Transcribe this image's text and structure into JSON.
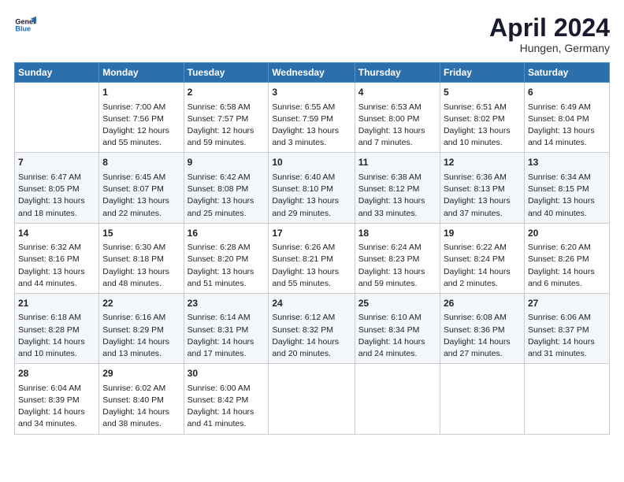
{
  "header": {
    "logo_line1": "General",
    "logo_line2": "Blue",
    "month": "April 2024",
    "location": "Hungen, Germany"
  },
  "days_of_week": [
    "Sunday",
    "Monday",
    "Tuesday",
    "Wednesday",
    "Thursday",
    "Friday",
    "Saturday"
  ],
  "weeks": [
    [
      {
        "day": "",
        "info": ""
      },
      {
        "day": "1",
        "info": "Sunrise: 7:00 AM\nSunset: 7:56 PM\nDaylight: 12 hours\nand 55 minutes."
      },
      {
        "day": "2",
        "info": "Sunrise: 6:58 AM\nSunset: 7:57 PM\nDaylight: 12 hours\nand 59 minutes."
      },
      {
        "day": "3",
        "info": "Sunrise: 6:55 AM\nSunset: 7:59 PM\nDaylight: 13 hours\nand 3 minutes."
      },
      {
        "day": "4",
        "info": "Sunrise: 6:53 AM\nSunset: 8:00 PM\nDaylight: 13 hours\nand 7 minutes."
      },
      {
        "day": "5",
        "info": "Sunrise: 6:51 AM\nSunset: 8:02 PM\nDaylight: 13 hours\nand 10 minutes."
      },
      {
        "day": "6",
        "info": "Sunrise: 6:49 AM\nSunset: 8:04 PM\nDaylight: 13 hours\nand 14 minutes."
      }
    ],
    [
      {
        "day": "7",
        "info": "Sunrise: 6:47 AM\nSunset: 8:05 PM\nDaylight: 13 hours\nand 18 minutes."
      },
      {
        "day": "8",
        "info": "Sunrise: 6:45 AM\nSunset: 8:07 PM\nDaylight: 13 hours\nand 22 minutes."
      },
      {
        "day": "9",
        "info": "Sunrise: 6:42 AM\nSunset: 8:08 PM\nDaylight: 13 hours\nand 25 minutes."
      },
      {
        "day": "10",
        "info": "Sunrise: 6:40 AM\nSunset: 8:10 PM\nDaylight: 13 hours\nand 29 minutes."
      },
      {
        "day": "11",
        "info": "Sunrise: 6:38 AM\nSunset: 8:12 PM\nDaylight: 13 hours\nand 33 minutes."
      },
      {
        "day": "12",
        "info": "Sunrise: 6:36 AM\nSunset: 8:13 PM\nDaylight: 13 hours\nand 37 minutes."
      },
      {
        "day": "13",
        "info": "Sunrise: 6:34 AM\nSunset: 8:15 PM\nDaylight: 13 hours\nand 40 minutes."
      }
    ],
    [
      {
        "day": "14",
        "info": "Sunrise: 6:32 AM\nSunset: 8:16 PM\nDaylight: 13 hours\nand 44 minutes."
      },
      {
        "day": "15",
        "info": "Sunrise: 6:30 AM\nSunset: 8:18 PM\nDaylight: 13 hours\nand 48 minutes."
      },
      {
        "day": "16",
        "info": "Sunrise: 6:28 AM\nSunset: 8:20 PM\nDaylight: 13 hours\nand 51 minutes."
      },
      {
        "day": "17",
        "info": "Sunrise: 6:26 AM\nSunset: 8:21 PM\nDaylight: 13 hours\nand 55 minutes."
      },
      {
        "day": "18",
        "info": "Sunrise: 6:24 AM\nSunset: 8:23 PM\nDaylight: 13 hours\nand 59 minutes."
      },
      {
        "day": "19",
        "info": "Sunrise: 6:22 AM\nSunset: 8:24 PM\nDaylight: 14 hours\nand 2 minutes."
      },
      {
        "day": "20",
        "info": "Sunrise: 6:20 AM\nSunset: 8:26 PM\nDaylight: 14 hours\nand 6 minutes."
      }
    ],
    [
      {
        "day": "21",
        "info": "Sunrise: 6:18 AM\nSunset: 8:28 PM\nDaylight: 14 hours\nand 10 minutes."
      },
      {
        "day": "22",
        "info": "Sunrise: 6:16 AM\nSunset: 8:29 PM\nDaylight: 14 hours\nand 13 minutes."
      },
      {
        "day": "23",
        "info": "Sunrise: 6:14 AM\nSunset: 8:31 PM\nDaylight: 14 hours\nand 17 minutes."
      },
      {
        "day": "24",
        "info": "Sunrise: 6:12 AM\nSunset: 8:32 PM\nDaylight: 14 hours\nand 20 minutes."
      },
      {
        "day": "25",
        "info": "Sunrise: 6:10 AM\nSunset: 8:34 PM\nDaylight: 14 hours\nand 24 minutes."
      },
      {
        "day": "26",
        "info": "Sunrise: 6:08 AM\nSunset: 8:36 PM\nDaylight: 14 hours\nand 27 minutes."
      },
      {
        "day": "27",
        "info": "Sunrise: 6:06 AM\nSunset: 8:37 PM\nDaylight: 14 hours\nand 31 minutes."
      }
    ],
    [
      {
        "day": "28",
        "info": "Sunrise: 6:04 AM\nSunset: 8:39 PM\nDaylight: 14 hours\nand 34 minutes."
      },
      {
        "day": "29",
        "info": "Sunrise: 6:02 AM\nSunset: 8:40 PM\nDaylight: 14 hours\nand 38 minutes."
      },
      {
        "day": "30",
        "info": "Sunrise: 6:00 AM\nSunset: 8:42 PM\nDaylight: 14 hours\nand 41 minutes."
      },
      {
        "day": "",
        "info": ""
      },
      {
        "day": "",
        "info": ""
      },
      {
        "day": "",
        "info": ""
      },
      {
        "day": "",
        "info": ""
      }
    ]
  ]
}
